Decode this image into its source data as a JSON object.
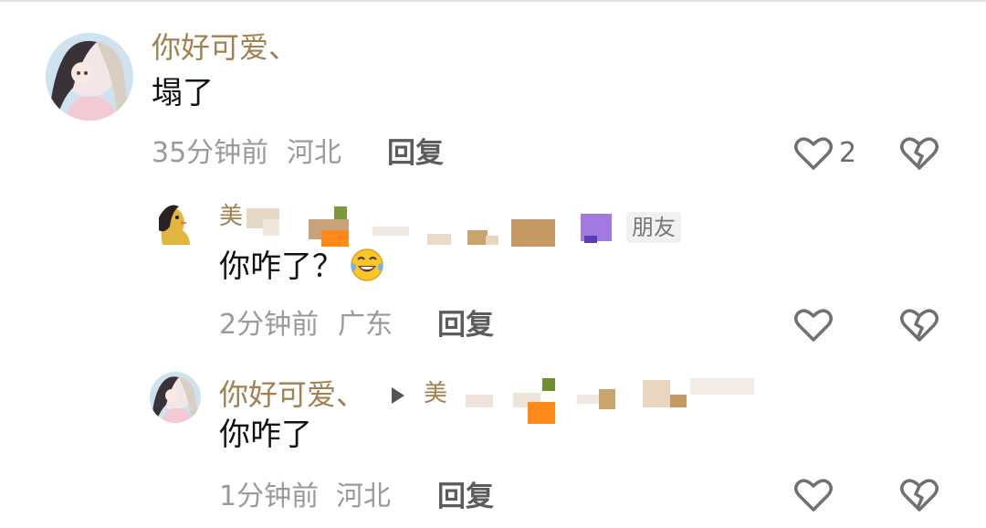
{
  "comments": [
    {
      "username": "你好可爱、",
      "text": "塌了",
      "time": "35分钟前",
      "location": "河北",
      "reply_label": "回复",
      "like_count": "2"
    },
    {
      "username": "美",
      "text": "你咋了？",
      "time": "2分钟前",
      "location": "广东",
      "reply_label": "回复",
      "badge": "朋友"
    },
    {
      "username": "你好可爱、",
      "reply_to": "美",
      "text": "你咋了",
      "time": "1分钟前",
      "location": "河北",
      "reply_label": "回复"
    }
  ],
  "icons": {
    "like": "heart-outline-icon",
    "dislike": "broken-heart-icon",
    "emoji": "laughing-tears-emoji",
    "reply_arrow": "play-arrow-icon"
  },
  "colors": {
    "username": "#a0814f",
    "meta": "#9a9a9a",
    "reply": "#5c5c5c",
    "icon": "#707070"
  }
}
